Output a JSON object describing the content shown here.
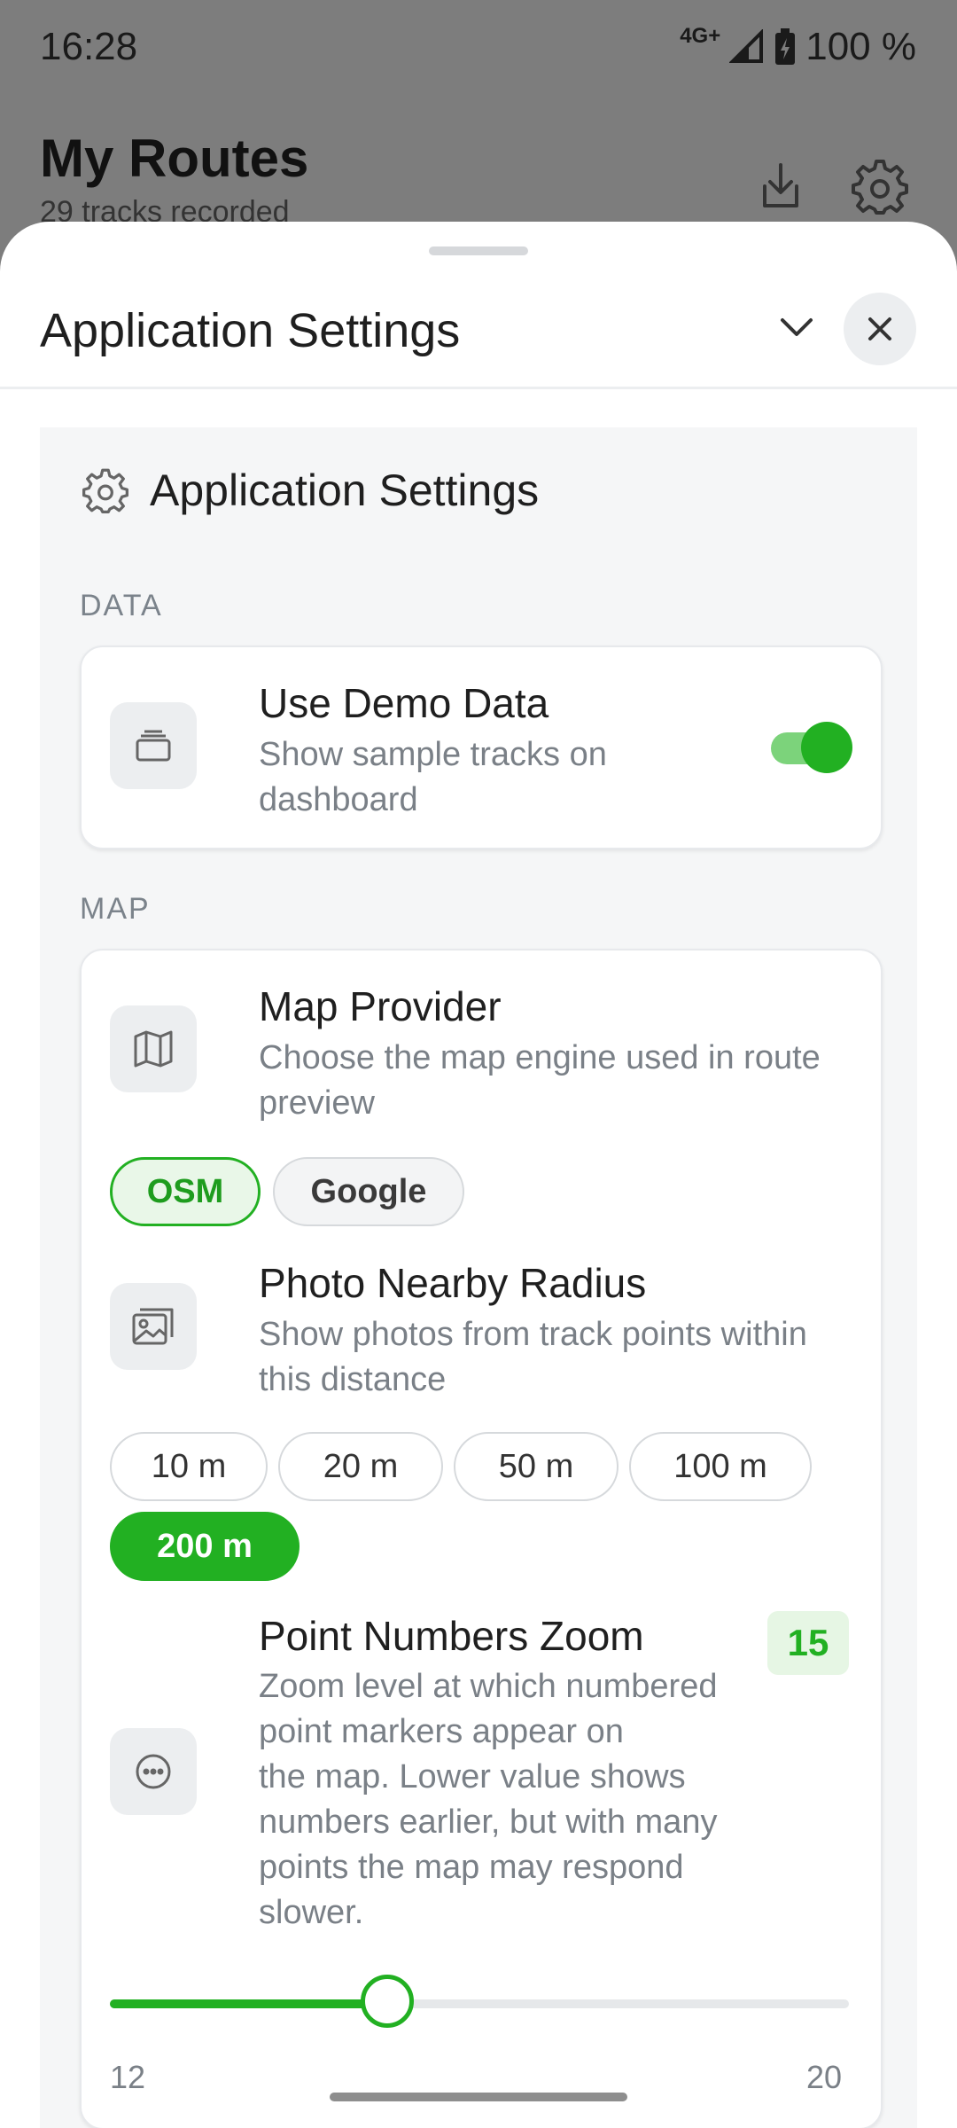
{
  "status": {
    "time": "16:28",
    "network": "4G+",
    "battery": "100 %"
  },
  "header": {
    "title": "My Routes",
    "subtitle": "29 tracks recorded"
  },
  "sheet": {
    "title": "Application Settings",
    "panel_title": "Application Settings",
    "sections": {
      "data_label": "DATA",
      "map_label": "MAP"
    },
    "demo": {
      "title": "Use Demo Data",
      "desc_line1": "Show sample tracks on",
      "desc_line2": "dashboard",
      "enabled": true
    },
    "provider": {
      "title": "Map Provider",
      "desc_line1": "Choose the map engine used in route",
      "desc_line2": "preview",
      "options": [
        "OSM",
        "Google"
      ],
      "selected": "OSM"
    },
    "radius": {
      "title": "Photo Nearby Radius",
      "desc_line1": "Show photos from track points within",
      "desc_line2": "this distance",
      "options": [
        "10 m",
        "20 m",
        "50 m",
        "100 m",
        "200 m"
      ],
      "selected": "200 m"
    },
    "zoom": {
      "title": "Point Numbers Zoom",
      "value": "15",
      "desc_lines": [
        "Zoom level at which numbered",
        "point markers appear on",
        "the map. Lower value shows",
        "numbers earlier, but with many",
        "points the map may respond",
        "slower."
      ],
      "min": "12",
      "max": "20",
      "fraction": 0.375
    }
  },
  "colors": {
    "accent": "#22b022",
    "scrim": "#7d7d7d"
  }
}
